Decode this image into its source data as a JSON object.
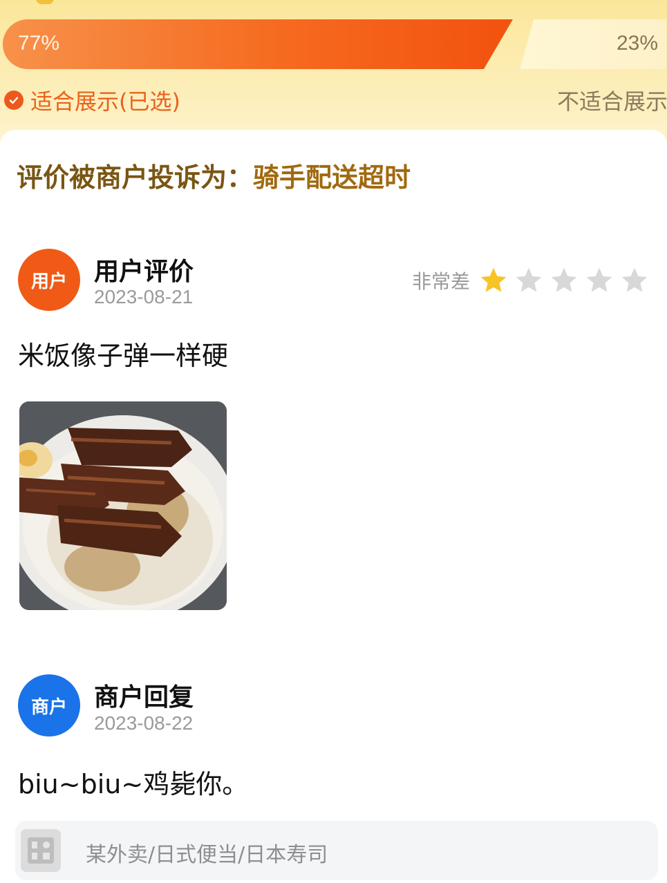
{
  "vote": {
    "suitable_percent": "77%",
    "unsuitable_percent": "23%",
    "suitable_fraction": 0.77,
    "suitable_label": "适合展示(已选)",
    "unsuitable_label": "不适合展示"
  },
  "complaint": {
    "prefix": "评价被商户投诉为：",
    "reason": "骑手配送超时"
  },
  "user_review": {
    "avatar_label": "用户",
    "title": "用户评价",
    "date": "2023-08-21",
    "rating_label": "非常差",
    "rating": 1,
    "max_rating": 5,
    "text": "米饭像子弹一样硬",
    "photo": "braised pork rice bowl"
  },
  "merchant_reply": {
    "avatar_label": "商户",
    "title": "商户回复",
    "date": "2023-08-22",
    "text": "biu~biu~鸡毙你。"
  },
  "shop": {
    "text": "某外卖/日式便当/日本寿司",
    "icon": "shop-icon"
  },
  "colors": {
    "accent": "#f2520f",
    "star_on": "#f7c325",
    "star_off": "#d8d8d8",
    "merchant_blue": "#1a73e8"
  }
}
